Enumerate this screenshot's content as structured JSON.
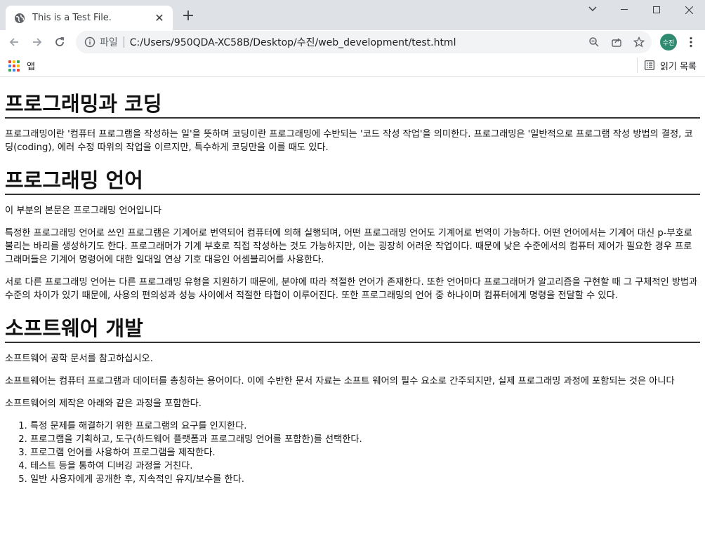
{
  "browser": {
    "tab_title": "This is a Test File.",
    "url_scheme_label": "파일",
    "url": "C:/Users/950QDA-XC58B/Desktop/수진/web_development/test.html",
    "profile_name": "수진",
    "bookmarks_apps_label": "앱",
    "reading_list_label": "읽기 목록"
  },
  "page": {
    "h1_1": "프로그래밍과 코딩",
    "p1": "프로그래밍이란 '컴퓨터 프로그램을 작성하는 일'을 뜻하며 코딩이란 프로그래밍에 수반되는 '코드 작성 작업'을 의미한다. 프로그래밍은 '일반적으로 프로그램 작성 방법의 결정, 코딩(coding), 에러 수정 따위의 작업을 이르지만, 특수하게 코딩만을 이를 때도 있다.",
    "h1_2": "프로그래밍 언어",
    "p2": "이 부분의 본문은 프로그래밍 언어입니다",
    "p3": "특정한 프로그래밍 언어로 쓰인 프로그램은 기계어로 번역되어 컴퓨터에 의해 실행되며, 어떤 프로그래밍 언어도 기계어로 번역이 가능하다. 어떤 언어에서는 기계어 대신 p-부호로 불리는 바리를 생성하기도 한다. 프로그래머가 기계 부호로 직접 작성하는 것도 가능하지만, 이는 굉장히 어려운 작업이다. 때문에 낮은 수준에서의 컴퓨터 제어가 필요한 경우 프로그래머들은 기계어 명령어에 대한 일대일 연상 기호 대응인 어셈블리어를 사용한다.",
    "p4": "서로 다른 프로그래밍 언어는 다른 프로그래밍 유형을 지원하기 때문에, 분야에 따라 적절한 언어가 존재한다. 또한 언어마다 프로그래머가 알고리즘을 구현할 때 그 구체적인 방법과 수준의 차이가 있기 때문에, 사용의 편의성과 성능 사이에서 적절한 타협이 이루어진다. 또한 프로그래밍의 언어 중 하나이며 컴퓨터에게 명령을 전달할 수 있다.",
    "h1_3": "소프트웨어 개발",
    "p5": "소프트웨어 공학 문서를 참고하십시오.",
    "p6": "소프트웨어는 컴퓨터 프로그램과 데이터를 총칭하는 용어이다. 이에 수반한 문서 자료는 소프트 웨어의 필수 요소로 간주되지만, 실제 프로그래밍 과정에 포함되는 것은 아니다",
    "p7": "소프트웨어의 제작은 아래와 같은 과정을 포함한다.",
    "steps": [
      "특정 문제를 해결하기 위한 프로그램의 요구를 인지한다.",
      "프로그램을 기획하고, 도구(하드웨어 플랫폼과 프로그래밍 언어를 포함한)를 선택한다.",
      "프로그램 언어를 사용하여 프로그램을 제작한다.",
      "테스트 등을 통하여 디버깅 과정을 거친다.",
      "일반 사용자에게 공개한 후, 지속적인 유지/보수를 한다."
    ]
  },
  "colors": {
    "tabstrip": "#dee1e6",
    "omnibox": "#f1f3f4",
    "avatar": "#2e8b6f"
  }
}
